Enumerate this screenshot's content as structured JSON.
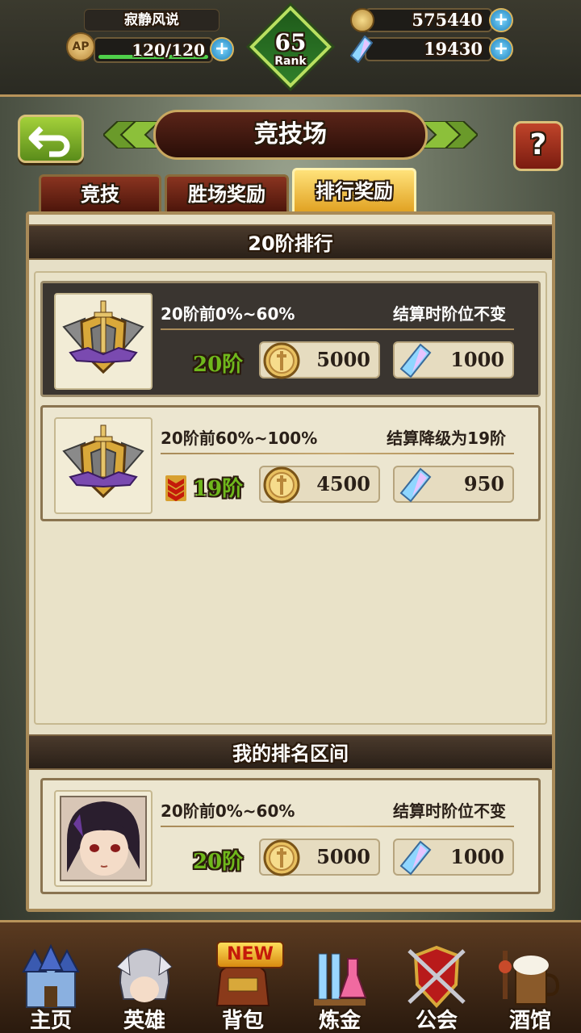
{
  "player": {
    "name": "寂静风说",
    "ap_label": "AP",
    "ap": "120/120",
    "ap_fill": 1.0,
    "rank_num": "65",
    "rank_label": "Rank"
  },
  "resources": {
    "gold": "575440",
    "crystal": "19430"
  },
  "header": {
    "title": "竞技场",
    "help": "?"
  },
  "tabs": [
    {
      "label": "竞技"
    },
    {
      "label": "胜场奖励"
    },
    {
      "label": "排行奖励",
      "active": true
    }
  ],
  "section_title": "20阶排行",
  "rewards": [
    {
      "range": "20阶前0%~60%",
      "note": "结算时阶位不变",
      "tier": "20阶",
      "gold": "5000",
      "crystal": "1000",
      "demote": false
    },
    {
      "range": "20阶前60%~100%",
      "note": "结算降级为19阶",
      "tier": "19阶",
      "gold": "4500",
      "crystal": "950",
      "demote": true
    }
  ],
  "my_section_title": "我的排名区间",
  "my_rank": {
    "range": "20阶前0%~60%",
    "note": "结算时阶位不变",
    "tier": "20阶",
    "gold": "5000",
    "crystal": "1000"
  },
  "nav": [
    {
      "label": "主页",
      "icon": "castle-icon"
    },
    {
      "label": "英雄",
      "icon": "hero-helmet-icon"
    },
    {
      "label": "背包",
      "icon": "bag-icon",
      "badge": "NEW"
    },
    {
      "label": "炼金",
      "icon": "alchemy-flask-icon"
    },
    {
      "label": "公会",
      "icon": "guild-shield-icon"
    },
    {
      "label": "酒馆",
      "icon": "tavern-mug-icon"
    }
  ],
  "colors": {
    "tier_green": "#6fb81c",
    "gold_coin": "#d9a83a",
    "accent_border": "#b8935a"
  }
}
